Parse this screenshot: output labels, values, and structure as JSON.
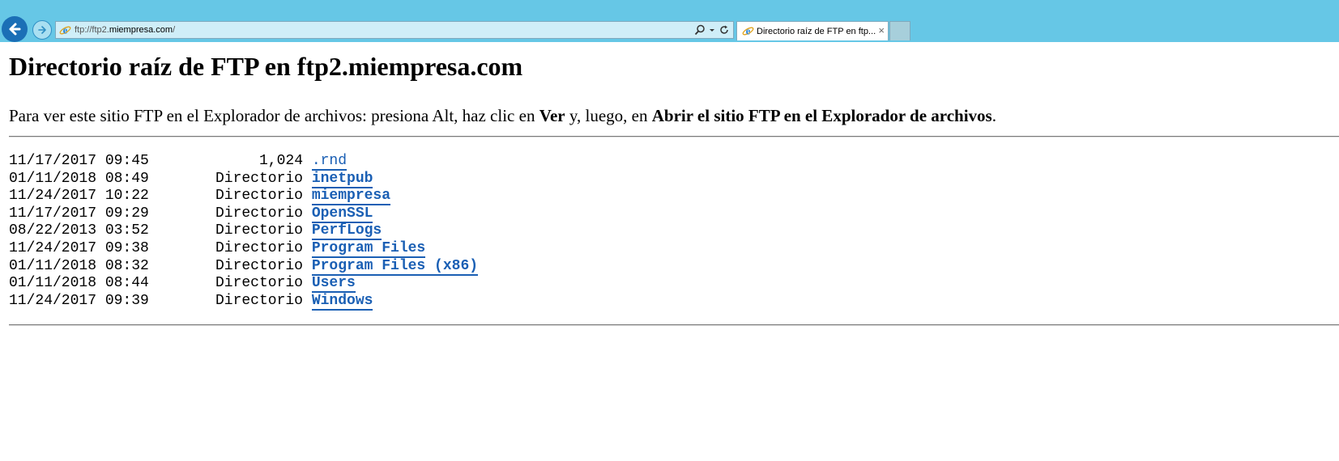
{
  "browser": {
    "address_scheme": "ftp://",
    "address_host": "ftp2.",
    "address_domain": "miempresa.com",
    "address_path": "/",
    "tab_title": "Directorio raíz de FTP en ftp...",
    "tab_close": "×",
    "accent_color": "#66c7e6"
  },
  "page": {
    "title": "Directorio raíz de FTP en ftp2.miempresa.com",
    "instruction_prefix": "Para ver este sitio FTP en el Explorador de archivos: presiona Alt, haz clic en ",
    "instruction_ver": "Ver",
    "instruction_mid": " y, luego, en ",
    "instruction_action": "Abrir el sitio FTP en el Explorador de archivos",
    "instruction_suffix": "."
  },
  "entries": [
    {
      "date": "11/17/2017 09:45",
      "size": "1,024",
      "name": ".rnd",
      "type": "file"
    },
    {
      "date": "01/11/2018 08:49",
      "size": "Directorio",
      "name": "inetpub",
      "type": "dir"
    },
    {
      "date": "11/24/2017 10:22",
      "size": "Directorio",
      "name": "miempresa",
      "type": "dir"
    },
    {
      "date": "11/17/2017 09:29",
      "size": "Directorio",
      "name": "OpenSSL",
      "type": "dir"
    },
    {
      "date": "08/22/2013 03:52",
      "size": "Directorio",
      "name": "PerfLogs",
      "type": "dir"
    },
    {
      "date": "11/24/2017 09:38",
      "size": "Directorio",
      "name": "Program Files",
      "type": "dir"
    },
    {
      "date": "01/11/2018 08:32",
      "size": "Directorio",
      "name": "Program Files (x86)",
      "type": "dir"
    },
    {
      "date": "01/11/2018 08:44",
      "size": "Directorio",
      "name": "Users",
      "type": "dir"
    },
    {
      "date": "11/24/2017 09:39",
      "size": "Directorio",
      "name": "Windows",
      "type": "dir"
    }
  ]
}
